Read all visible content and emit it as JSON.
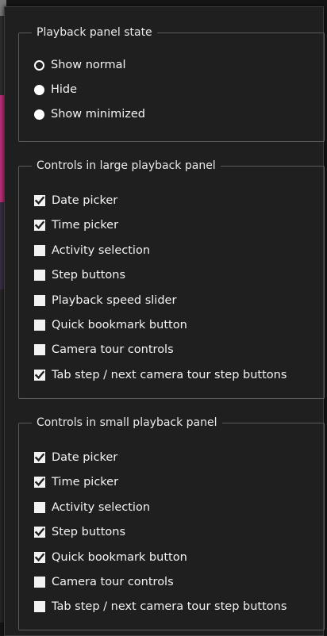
{
  "state_group": {
    "legend": "Playback panel state",
    "options": [
      {
        "label": "Show normal",
        "selected": true
      },
      {
        "label": "Hide",
        "selected": false
      },
      {
        "label": "Show minimized",
        "selected": false
      }
    ]
  },
  "large_group": {
    "legend": "Controls in large playback panel",
    "items": [
      {
        "label": "Date picker",
        "checked": true
      },
      {
        "label": "Time picker",
        "checked": true
      },
      {
        "label": "Activity selection",
        "checked": false
      },
      {
        "label": "Step buttons",
        "checked": false
      },
      {
        "label": "Playback speed slider",
        "checked": false
      },
      {
        "label": "Quick bookmark button",
        "checked": false
      },
      {
        "label": "Camera tour controls",
        "checked": false
      },
      {
        "label": "Tab step / next camera tour step buttons",
        "checked": true
      }
    ]
  },
  "small_group": {
    "legend": "Controls in small playback panel",
    "items": [
      {
        "label": "Date picker",
        "checked": true
      },
      {
        "label": "Time picker",
        "checked": true
      },
      {
        "label": "Activity selection",
        "checked": false
      },
      {
        "label": "Step buttons",
        "checked": true
      },
      {
        "label": "Quick bookmark button",
        "checked": true
      },
      {
        "label": "Camera tour controls",
        "checked": false
      },
      {
        "label": "Tab step / next camera tour step buttons",
        "checked": false
      }
    ]
  },
  "colors": {
    "panel_bg": "#1f1f1f",
    "text": "#f3f3f3",
    "border": "#5a5a5a",
    "checkbox_fill": "#f2f2f2",
    "check_mark": "#1f1f1f"
  },
  "icons": {
    "radio_selected": "radio-selected-icon",
    "radio_unselected": "radio-unselected-icon",
    "checkbox_checked": "checkbox-checked-icon",
    "checkbox_unchecked": "checkbox-unchecked-icon"
  }
}
